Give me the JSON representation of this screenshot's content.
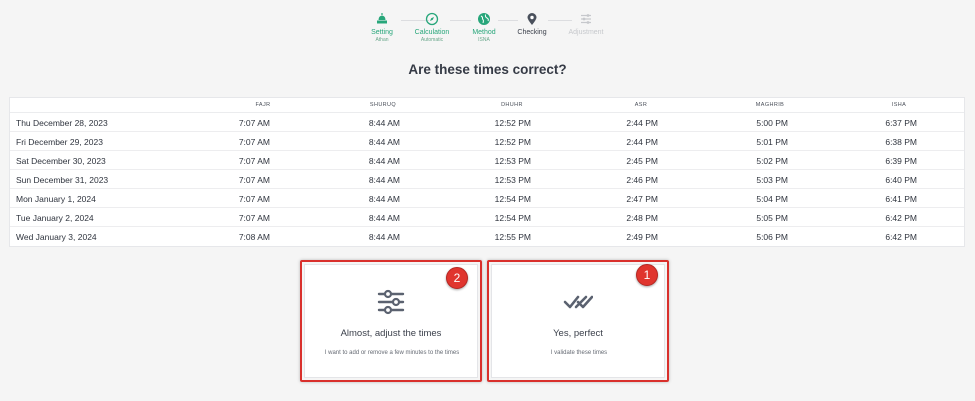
{
  "stepper": {
    "steps": [
      {
        "label": "Setting",
        "sub": "Athan",
        "state": "done",
        "icon": "mosque-icon"
      },
      {
        "label": "Calculation",
        "sub": "Automatic",
        "state": "done",
        "icon": "compass-icon"
      },
      {
        "label": "Method",
        "sub": "ISNA",
        "state": "done",
        "icon": "globe-icon"
      },
      {
        "label": "Checking",
        "sub": "",
        "state": "active",
        "icon": "map-pin-icon"
      },
      {
        "label": "Adjustment",
        "sub": "",
        "state": "pending",
        "icon": "sliders-icon"
      }
    ]
  },
  "question": "Are these times correct?",
  "table": {
    "headers": [
      "FAJR",
      "SHURUQ",
      "DHUHR",
      "ASR",
      "MAGHRIB",
      "ISHA"
    ],
    "rows": [
      {
        "date": "Thu December 28, 2023",
        "times": [
          "7:07 AM",
          "8:44 AM",
          "12:52 PM",
          "2:44 PM",
          "5:00 PM",
          "6:37 PM"
        ]
      },
      {
        "date": "Fri December 29, 2023",
        "times": [
          "7:07 AM",
          "8:44 AM",
          "12:52 PM",
          "2:44 PM",
          "5:01 PM",
          "6:38 PM"
        ]
      },
      {
        "date": "Sat December 30, 2023",
        "times": [
          "7:07 AM",
          "8:44 AM",
          "12:53 PM",
          "2:45 PM",
          "5:02 PM",
          "6:39 PM"
        ]
      },
      {
        "date": "Sun December 31, 2023",
        "times": [
          "7:07 AM",
          "8:44 AM",
          "12:53 PM",
          "2:46 PM",
          "5:03 PM",
          "6:40 PM"
        ]
      },
      {
        "date": "Mon January 1, 2024",
        "times": [
          "7:07 AM",
          "8:44 AM",
          "12:54 PM",
          "2:47 PM",
          "5:04 PM",
          "6:41 PM"
        ]
      },
      {
        "date": "Tue January 2, 2024",
        "times": [
          "7:07 AM",
          "8:44 AM",
          "12:54 PM",
          "2:48 PM",
          "5:05 PM",
          "6:42 PM"
        ]
      },
      {
        "date": "Wed January 3, 2024",
        "times": [
          "7:08 AM",
          "8:44 AM",
          "12:55 PM",
          "2:49 PM",
          "5:06 PM",
          "6:42 PM"
        ]
      }
    ]
  },
  "options": {
    "adjust": {
      "title": "Almost, adjust the times",
      "desc": "I want to add or remove a few minutes to the times",
      "badge": "2",
      "icon": "sliders-icon"
    },
    "perfect": {
      "title": "Yes, perfect",
      "desc": "I validate these times",
      "badge": "1",
      "icon": "double-check-icon"
    }
  },
  "colors": {
    "accent_green": "#27a67a",
    "highlight_red": "#d9302c",
    "icon_gray": "#5b6270",
    "background": "#f5f5f5"
  }
}
